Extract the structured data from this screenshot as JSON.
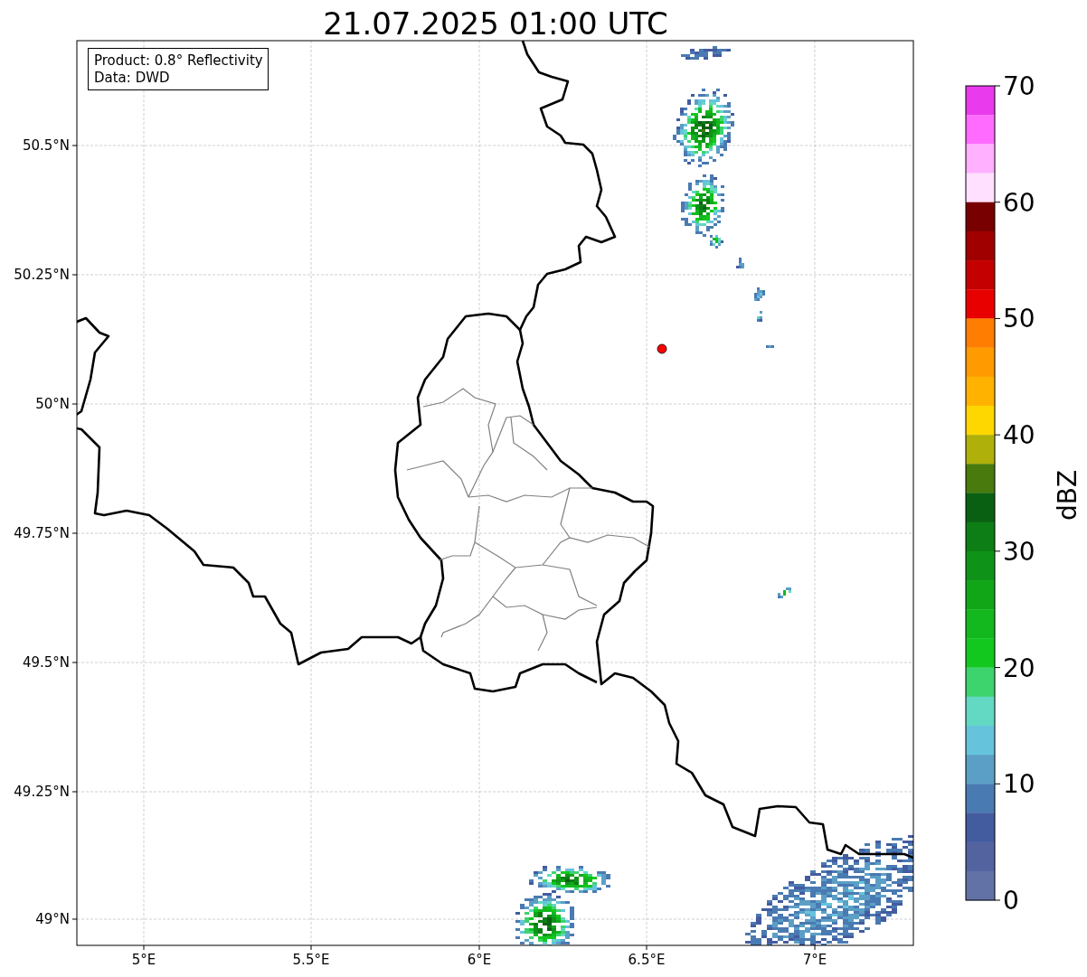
{
  "title": "21.07.2025 01:00 UTC",
  "annotation": {
    "lines": [
      "Product: 0.8° Reflectivity",
      "Data: DWD"
    ]
  },
  "x_ticks": [
    "5°E",
    "5.5°E",
    "6°E",
    "6.5°E",
    "7°E"
  ],
  "y_ticks": [
    "50.5°N",
    "50.25°N",
    "50°N",
    "49.75°N",
    "49.5°N",
    "49.25°N",
    "49°N"
  ],
  "colorbar": {
    "label": "dBZ",
    "ticks": [
      "70",
      "60",
      "50",
      "40",
      "30",
      "20",
      "10",
      "0"
    ],
    "segments": [
      {
        "color": "#e93aed"
      },
      {
        "color": "#ff6bff"
      },
      {
        "color": "#ffb0ff"
      },
      {
        "color": "#ffe0ff"
      },
      {
        "color": "#780000"
      },
      {
        "color": "#a00000"
      },
      {
        "color": "#c40000"
      },
      {
        "color": "#e80000"
      },
      {
        "color": "#ff7d00"
      },
      {
        "color": "#ff9a00"
      },
      {
        "color": "#ffb300"
      },
      {
        "color": "#ffd700"
      },
      {
        "color": "#b0b00a"
      },
      {
        "color": "#487a0e"
      },
      {
        "color": "#0a6012"
      },
      {
        "color": "#0d7d15"
      },
      {
        "color": "#0e9318"
      },
      {
        "color": "#11a618"
      },
      {
        "color": "#12b81e"
      },
      {
        "color": "#12c81e"
      },
      {
        "color": "#3dd46e"
      },
      {
        "color": "#63d8c2"
      },
      {
        "color": "#66c3dc"
      },
      {
        "color": "#5b9fc6"
      },
      {
        "color": "#4a7ab2"
      },
      {
        "color": "#435ca0"
      },
      {
        "color": "#52639f"
      },
      {
        "color": "#6271a6"
      }
    ]
  }
}
